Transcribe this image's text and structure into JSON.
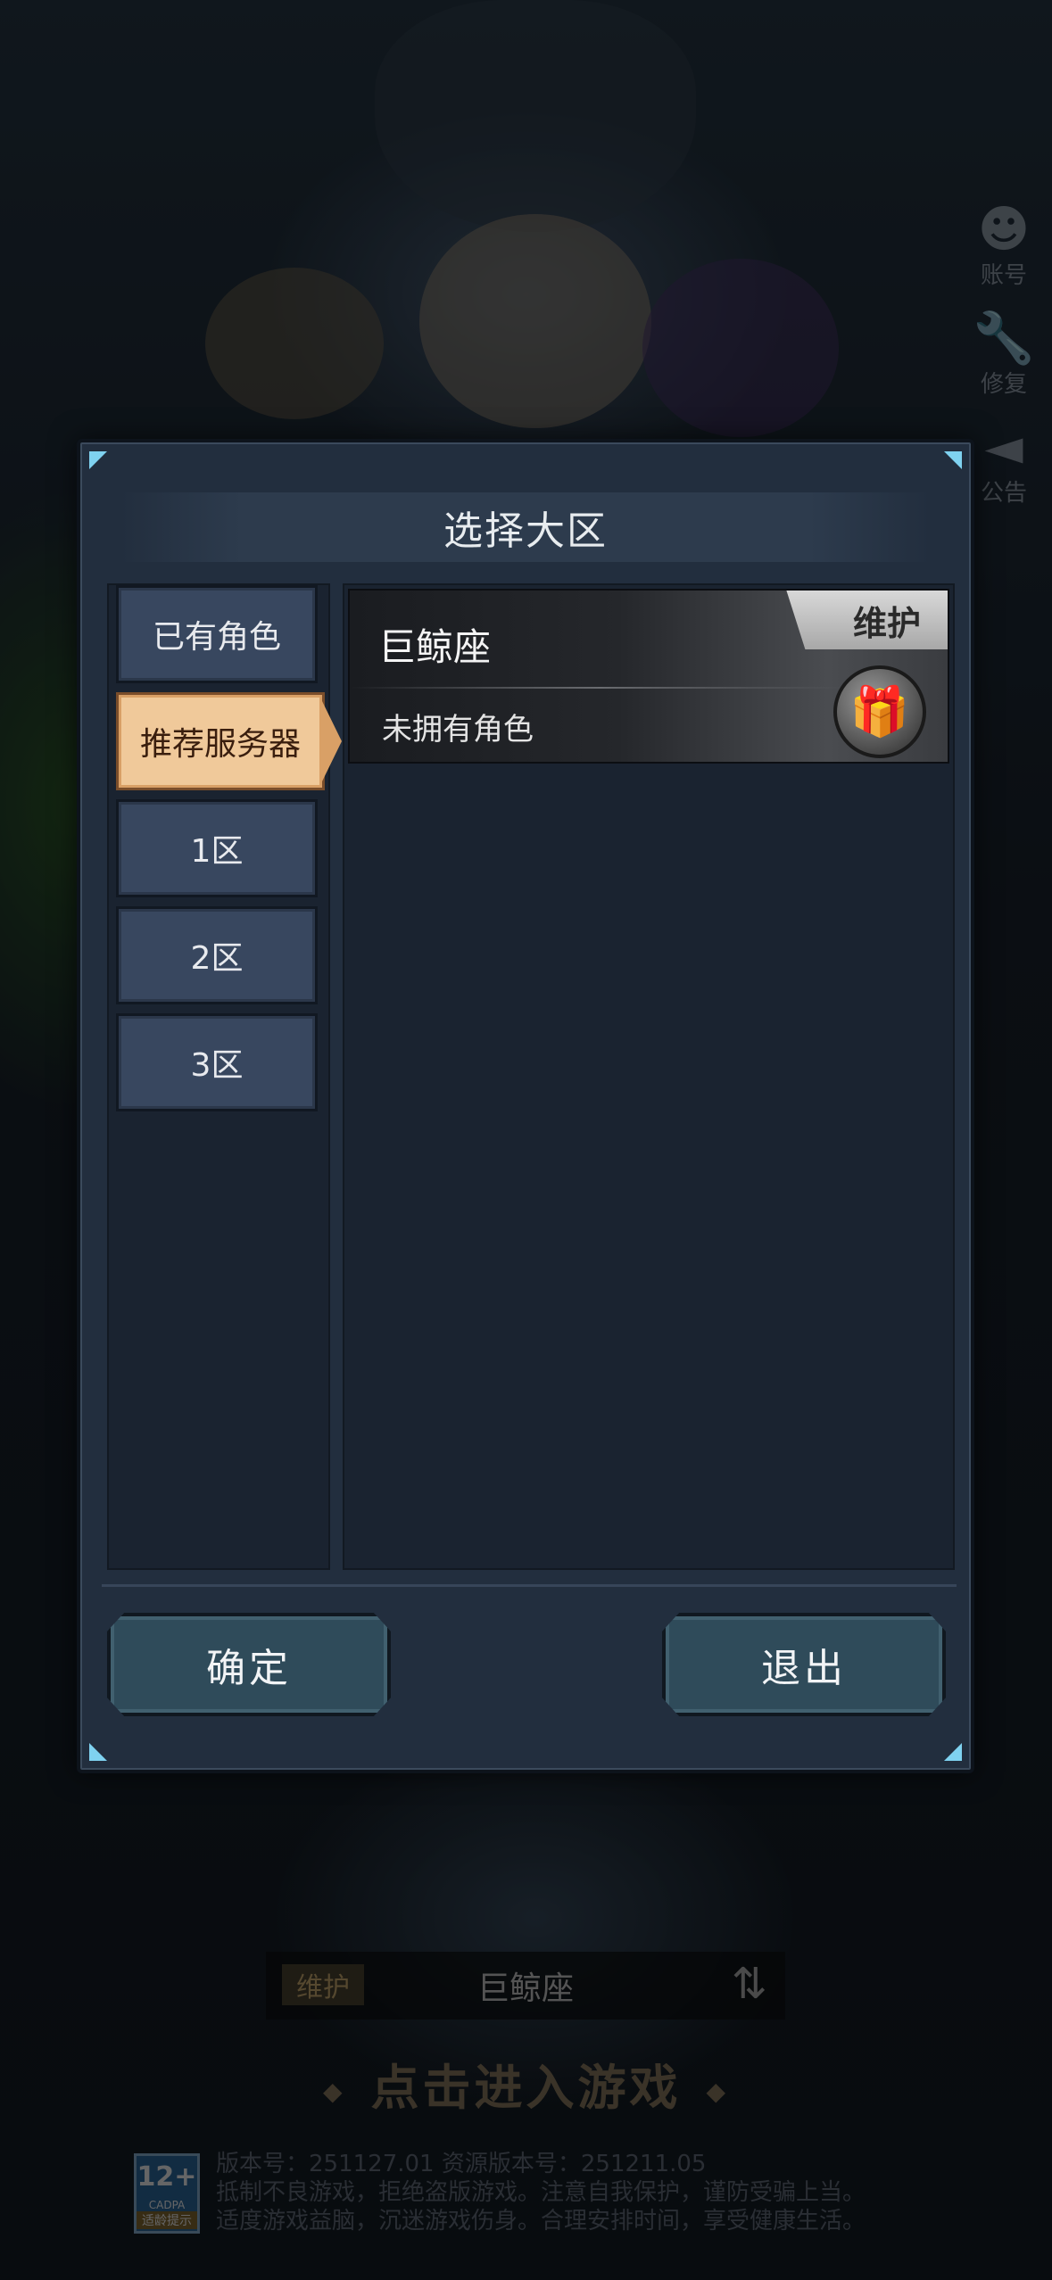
{
  "side_icons": [
    {
      "label": "账号",
      "icon": "account-icon"
    },
    {
      "label": "修复",
      "icon": "wrench-icon"
    },
    {
      "label": "公告",
      "icon": "megaphone-icon"
    }
  ],
  "dialog": {
    "title": "选择大区",
    "categories": [
      {
        "label": "已有角色",
        "active": false
      },
      {
        "label": "推荐服务器",
        "active": true
      },
      {
        "label": "1区",
        "active": false
      },
      {
        "label": "2区",
        "active": false
      },
      {
        "label": "3区",
        "active": false
      }
    ],
    "servers": [
      {
        "name": "巨鲸座",
        "status": "维护",
        "role_text": "未拥有角色",
        "icon": "gift-icon"
      }
    ],
    "confirm_label": "确定",
    "quit_label": "退出"
  },
  "bottom": {
    "server_status": "维护",
    "server_name": "巨鲸座",
    "enter_label": "点击进入游戏",
    "age_rating": "12+",
    "age_org": "CADPA",
    "age_tip": "适龄提示",
    "version_line": "版本号：251127.01  资源版本号：251211.05",
    "notice_line1": "抵制不良游戏，拒绝盗版游戏。注意自我保护，谨防受骗上当。",
    "notice_line2": "适度游戏益脑，沉迷游戏伤身。合理安排时间，享受健康生活。"
  }
}
